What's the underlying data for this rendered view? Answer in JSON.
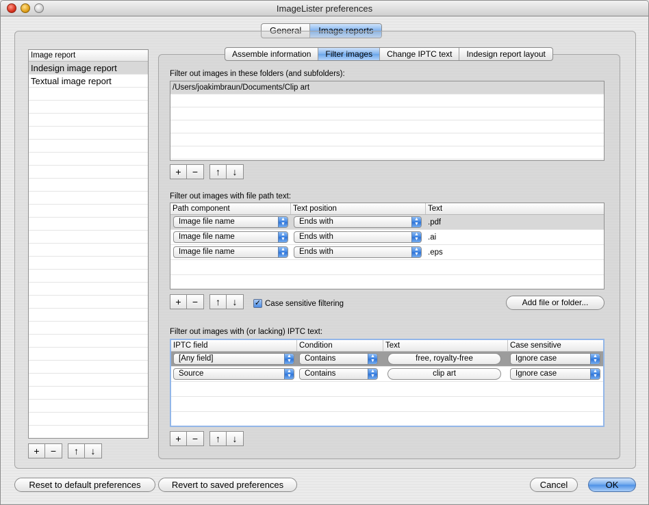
{
  "window": {
    "title": "ImageLister preferences"
  },
  "top_tabs": [
    {
      "label": "General",
      "selected": false
    },
    {
      "label": "Image reports",
      "selected": true
    }
  ],
  "report_list": {
    "header": "Image report",
    "items": [
      {
        "label": "Indesign image report",
        "selected": true
      },
      {
        "label": "Textual image report",
        "selected": false
      }
    ],
    "buttons": [
      "+",
      "−",
      "↑",
      "↓"
    ]
  },
  "sub_tabs": [
    {
      "label": "Assemble information",
      "selected": false
    },
    {
      "label": "Filter images",
      "selected": true
    },
    {
      "label": "Change IPTC text",
      "selected": false
    },
    {
      "label": "Indesign report layout",
      "selected": false
    }
  ],
  "folders_section": {
    "label": "Filter out images in these folders (and subfolders):",
    "items": [
      "/Users/joakimbraun/Documents/Clip art"
    ],
    "buttons": [
      "+",
      "−",
      "↑",
      "↓"
    ]
  },
  "path_section": {
    "label": "Filter out images with file path text:",
    "columns": [
      "Path component",
      "Text position",
      "Text"
    ],
    "rows": [
      {
        "component": "Image file name",
        "position": "Ends with",
        "text": ".pdf"
      },
      {
        "component": "Image file name",
        "position": "Ends with",
        "text": ".ai"
      },
      {
        "component": "Image file name",
        "position": "Ends with",
        "text": ".eps"
      }
    ],
    "buttons": [
      "+",
      "−",
      "↑",
      "↓"
    ],
    "case_sensitive_label": "Case sensitive filtering",
    "case_sensitive_checked": true,
    "add_button": "Add file or folder..."
  },
  "iptc_section": {
    "label": "Filter out images with (or lacking) IPTC text:",
    "columns": [
      "IPTC field",
      "Condition",
      "Text",
      "Case sensitive"
    ],
    "rows": [
      {
        "field": "[Any field]",
        "condition": "Contains",
        "text": "free, royalty-free",
        "case": "Ignore case"
      },
      {
        "field": "Source",
        "condition": "Contains",
        "text": "clip art",
        "case": "Ignore case"
      }
    ],
    "buttons": [
      "+",
      "−",
      "↑",
      "↓"
    ]
  },
  "footer": {
    "reset_label": "Reset to default preferences",
    "revert_label": "Revert to saved preferences",
    "cancel_label": "Cancel",
    "ok_label": "OK"
  },
  "colors": {
    "accent": "#6aa5ea",
    "selection": "#d8d8d8"
  }
}
